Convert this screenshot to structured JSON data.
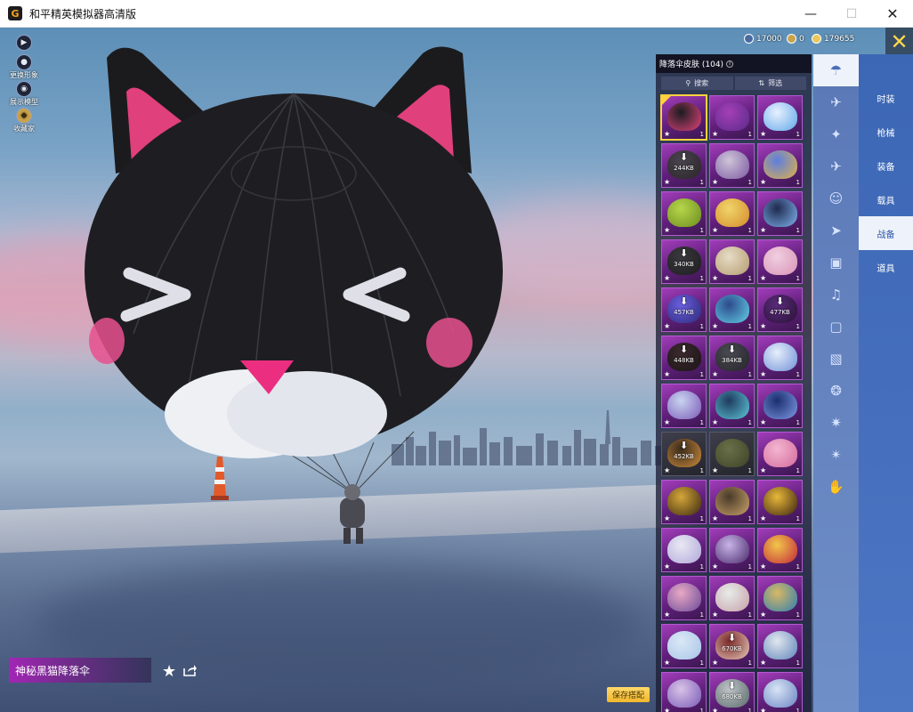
{
  "window": {
    "title": "和平精英模拟器高清版",
    "icon": "app-logo-icon",
    "controls": [
      "minimize-icon",
      "maximize-icon",
      "close-icon"
    ]
  },
  "left_menu": [
    {
      "icon": "play-icon",
      "label": ""
    },
    {
      "icon": "person-icon",
      "label": "更换形象"
    },
    {
      "icon": "eye-icon",
      "label": "展示模型"
    },
    {
      "icon": "collection-icon",
      "label": "收藏家"
    }
  ],
  "currencies": [
    {
      "icon": "points-coin-icon",
      "value": "17000",
      "color": "#4a6aa0"
    },
    {
      "icon": "gold-coin-icon",
      "value": "0",
      "color": "#c9a24a"
    },
    {
      "icon": "diamond-icon",
      "value": "179655",
      "color": "#e8c85a"
    }
  ],
  "panel": {
    "title": "降落伞皮肤 (104)",
    "search_label": "搜索",
    "filter_label": "筛选",
    "items": [
      {
        "colors": [
          "#1c1c1f",
          "#e0447b"
        ],
        "size": "",
        "count": "1",
        "selected": true,
        "dark": false
      },
      {
        "colors": [
          "#a43fb6",
          "#5a2b8a"
        ],
        "size": "",
        "count": "1",
        "selected": false,
        "dark": false
      },
      {
        "colors": [
          "#e8f0ff",
          "#5fa7e8"
        ],
        "size": "",
        "count": "1",
        "selected": false,
        "dark": false
      },
      {
        "colors": [
          "#4a4450",
          "#2a2628"
        ],
        "size": "244KB",
        "count": "1",
        "selected": false,
        "dark": false
      },
      {
        "colors": [
          "#cfc4d8",
          "#7b5aa2"
        ],
        "size": "",
        "count": "1",
        "selected": false,
        "dark": false
      },
      {
        "colors": [
          "#5d7ee0",
          "#e1b148"
        ],
        "size": "",
        "count": "1",
        "selected": false,
        "dark": false
      },
      {
        "colors": [
          "#b7d64a",
          "#6b8d1f"
        ],
        "size": "",
        "count": "1",
        "selected": false,
        "dark": false
      },
      {
        "colors": [
          "#f1d56a",
          "#d48b2c"
        ],
        "size": "",
        "count": "1",
        "selected": false,
        "dark": false
      },
      {
        "colors": [
          "#1f2a4e",
          "#7fb3f0"
        ],
        "size": "",
        "count": "1",
        "selected": false,
        "dark": false
      },
      {
        "colors": [
          "#3a3a3e",
          "#1d1d20"
        ],
        "size": "340KB",
        "count": "1",
        "selected": false,
        "dark": false
      },
      {
        "colors": [
          "#e6dcc6",
          "#b59b70"
        ],
        "size": "",
        "count": "1",
        "selected": false,
        "dark": false
      },
      {
        "colors": [
          "#f0cfe0",
          "#d893b6"
        ],
        "size": "",
        "count": "1",
        "selected": false,
        "dark": false
      },
      {
        "colors": [
          "#6b5ee0",
          "#2c2a78"
        ],
        "size": "457KB",
        "count": "1",
        "selected": false,
        "dark": false
      },
      {
        "colors": [
          "#2d4a8c",
          "#62d0e8"
        ],
        "size": "",
        "count": "1",
        "selected": false,
        "dark": false
      },
      {
        "colors": [
          "#5a2b7a",
          "#2a1238"
        ],
        "size": "477KB",
        "count": "1",
        "selected": false,
        "dark": false
      },
      {
        "colors": [
          "#3a2a2e",
          "#1c1416"
        ],
        "size": "448KB",
        "count": "1",
        "selected": false,
        "dark": false
      },
      {
        "colors": [
          "#4a4a52",
          "#25252a"
        ],
        "size": "384KB",
        "count": "1",
        "selected": false,
        "dark": false
      },
      {
        "colors": [
          "#e6eefb",
          "#6f8fd6"
        ],
        "size": "",
        "count": "1",
        "selected": false,
        "dark": false
      },
      {
        "colors": [
          "#c9d4f0",
          "#7a5ab8"
        ],
        "size": "",
        "count": "1",
        "selected": false,
        "dark": false
      },
      {
        "colors": [
          "#1e3a5e",
          "#5ec7d8"
        ],
        "size": "",
        "count": "1",
        "selected": false,
        "dark": false
      },
      {
        "colors": [
          "#1b2e6e",
          "#7f9ae6"
        ],
        "size": "",
        "count": "1",
        "selected": false,
        "dark": false
      },
      {
        "colors": [
          "#3a2a1c",
          "#c98a3a"
        ],
        "size": "452KB",
        "count": "1",
        "selected": false,
        "dark": true
      },
      {
        "colors": [
          "#6a7048",
          "#3e4228"
        ],
        "size": "",
        "count": "1",
        "selected": false,
        "dark": true
      },
      {
        "colors": [
          "#f3b6cf",
          "#d46a9e"
        ],
        "size": "",
        "count": "1",
        "selected": false,
        "dark": false
      },
      {
        "colors": [
          "#d6a63a",
          "#3a2a10"
        ],
        "size": "",
        "count": "1",
        "selected": false,
        "dark": false
      },
      {
        "colors": [
          "#4a3a2a",
          "#c8a36a"
        ],
        "size": "",
        "count": "1",
        "selected": false,
        "dark": false
      },
      {
        "colors": [
          "#e8b83a",
          "#3a2410"
        ],
        "size": "",
        "count": "1",
        "selected": false,
        "dark": false
      },
      {
        "colors": [
          "#e9e8f4",
          "#b0a8d8"
        ],
        "size": "",
        "count": "1",
        "selected": false,
        "dark": false
      },
      {
        "colors": [
          "#c7b4e8",
          "#4a2a6a"
        ],
        "size": "",
        "count": "1",
        "selected": false,
        "dark": false
      },
      {
        "colors": [
          "#f2c64a",
          "#c2283a"
        ],
        "size": "",
        "count": "1",
        "selected": false,
        "dark": false
      },
      {
        "colors": [
          "#e8a9c4",
          "#6a4a9a"
        ],
        "size": "",
        "count": "1",
        "selected": false,
        "dark": false
      },
      {
        "colors": [
          "#e7ece9",
          "#c7a0a8"
        ],
        "size": "",
        "count": "1",
        "selected": false,
        "dark": false
      },
      {
        "colors": [
          "#d8b864",
          "#2d7fb0"
        ],
        "size": "",
        "count": "1",
        "selected": false,
        "dark": false
      },
      {
        "colors": [
          "#dbe8f6",
          "#a8c4e8"
        ],
        "size": "",
        "count": "1",
        "selected": false,
        "dark": false
      },
      {
        "colors": [
          "#7a2a2a",
          "#e8c8b8"
        ],
        "size": "670KB",
        "count": "1",
        "selected": false,
        "dark": false
      },
      {
        "colors": [
          "#e2e6ef",
          "#5d86b8"
        ],
        "size": "",
        "count": "1",
        "selected": false,
        "dark": false
      },
      {
        "colors": [
          "#d9c3e6",
          "#7a5ab8"
        ],
        "size": "",
        "count": "1",
        "selected": false,
        "dark": false
      },
      {
        "colors": [
          "#bfc4c8",
          "#5a6a6a"
        ],
        "size": "680KB",
        "count": "1",
        "selected": false,
        "dark": false
      },
      {
        "colors": [
          "#d8e4f4",
          "#6a84c4"
        ],
        "size": "",
        "count": "1",
        "selected": false,
        "dark": false
      }
    ]
  },
  "icon_column": [
    {
      "icon": "parachute-icon",
      "active": true
    },
    {
      "icon": "glider-icon",
      "active": false
    },
    {
      "icon": "drone-icon",
      "active": false
    },
    {
      "icon": "plane-icon",
      "active": false
    },
    {
      "icon": "emote-icon",
      "active": false
    },
    {
      "icon": "jet-icon",
      "active": false
    },
    {
      "icon": "robot-icon",
      "active": false
    },
    {
      "icon": "sound-icon",
      "active": false
    },
    {
      "icon": "frame-icon",
      "active": false
    },
    {
      "icon": "photo-icon",
      "active": false
    },
    {
      "icon": "spray-icon",
      "active": false
    },
    {
      "icon": "effect-icon",
      "active": false
    },
    {
      "icon": "wand-icon",
      "active": false
    },
    {
      "icon": "hand-icon",
      "active": false
    }
  ],
  "categories": [
    {
      "label": "时装",
      "active": false
    },
    {
      "label": "枪械",
      "active": false
    },
    {
      "label": "装备",
      "active": false
    },
    {
      "label": "载具",
      "active": false
    },
    {
      "label": "战备",
      "active": true
    },
    {
      "label": "道具",
      "active": false
    }
  ],
  "selected_item": {
    "name": "神秘黑猫降落伞",
    "favorite_icon": "star-icon",
    "share_icon": "share-icon"
  },
  "save_button": "保存搭配"
}
